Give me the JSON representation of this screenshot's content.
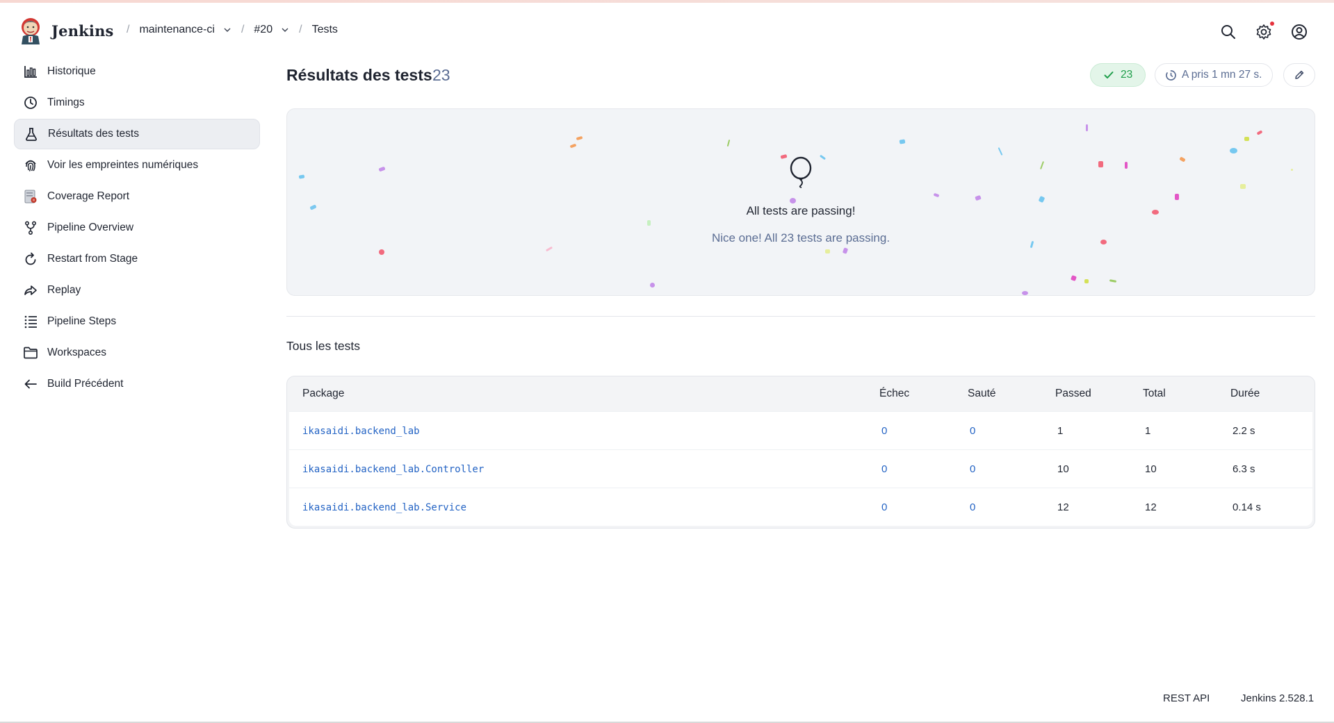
{
  "header": {
    "brand": "Jenkins",
    "breadcrumbs": [
      {
        "label": "maintenance-ci",
        "has_dropdown": true
      },
      {
        "label": "#20",
        "has_dropdown": true
      },
      {
        "label": "Tests",
        "has_dropdown": false
      }
    ],
    "icons": [
      "search-icon",
      "settings-icon",
      "account-icon"
    ],
    "notification_color": "#e5323c"
  },
  "sidebar": {
    "items": [
      {
        "label": "Historique",
        "icon": "chart-icon",
        "active": false
      },
      {
        "label": "Timings",
        "icon": "clock-icon",
        "active": false
      },
      {
        "label": "Résultats des tests",
        "icon": "flask-icon",
        "active": true
      },
      {
        "label": "Voir les empreintes numériques",
        "icon": "fingerprint-icon",
        "active": false
      },
      {
        "label": "Coverage Report",
        "icon": "coverage-icon",
        "active": false
      },
      {
        "label": "Pipeline Overview",
        "icon": "pipeline-icon",
        "active": false
      },
      {
        "label": "Restart from Stage",
        "icon": "restart-icon",
        "active": false
      },
      {
        "label": "Replay",
        "icon": "replay-icon",
        "active": false
      },
      {
        "label": "Pipeline Steps",
        "icon": "steps-icon",
        "active": false
      },
      {
        "label": "Workspaces",
        "icon": "folder-icon",
        "active": false
      },
      {
        "label": "Build Précédent",
        "icon": "arrow-left-icon",
        "active": false
      }
    ]
  },
  "main": {
    "title": "Résultats des tests",
    "count": "23",
    "passed_badge": "23",
    "duration_badge": "A pris 1 mn 27 s.",
    "celebration": {
      "title": "All tests are passing!",
      "subtitle": "Nice one! All 23 tests are passing."
    },
    "section_title": "Tous les tests",
    "table": {
      "columns": [
        "Package",
        "Échec",
        "Sauté",
        "Passed",
        "Total",
        "Durée"
      ],
      "rows": [
        {
          "package": "ikasaidi.backend_lab",
          "echec": "0",
          "saute": "0",
          "passed": "1",
          "total": "1",
          "duree": "2.2 s"
        },
        {
          "package": "ikasaidi.backend_lab.Controller",
          "echec": "0",
          "saute": "0",
          "passed": "10",
          "total": "10",
          "duree": "6.3 s"
        },
        {
          "package": "ikasaidi.backend_lab.Service",
          "echec": "0",
          "saute": "0",
          "passed": "12",
          "total": "12",
          "duree": "0.14 s"
        }
      ]
    }
  },
  "footer": {
    "rest_api": "REST API",
    "version": "Jenkins 2.528.1"
  },
  "colors": {
    "accent_link": "#2363c4",
    "success": "#1e9e4a",
    "muted": "#5b6d93"
  }
}
